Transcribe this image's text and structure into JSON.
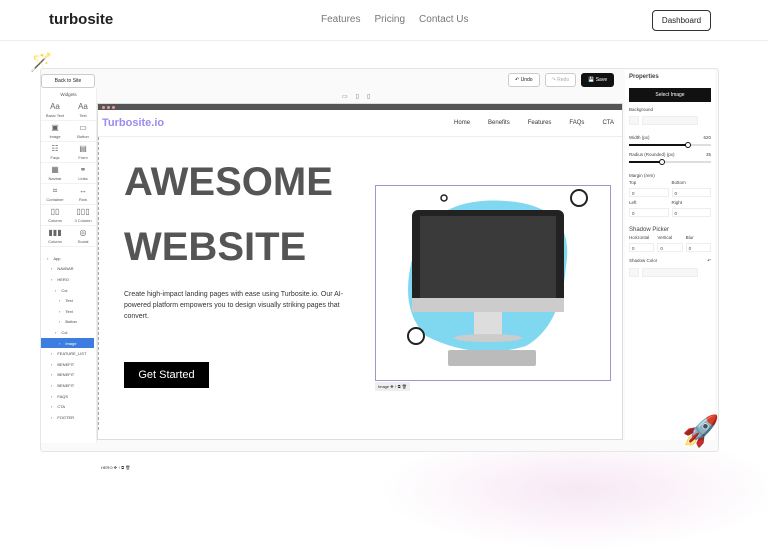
{
  "nav": {
    "logo": "turbosite",
    "links": [
      "Features",
      "Pricing",
      "Contact Us"
    ],
    "dashboard": "Dashboard"
  },
  "editor": {
    "back": "Back to Site",
    "widgets_title": "Widgets",
    "widgets": [
      {
        "label": "Basic Text",
        "icon": "Aa"
      },
      {
        "label": "Text",
        "icon": "Aa"
      },
      {
        "label": "Image",
        "icon": "▣"
      },
      {
        "label": "Button",
        "icon": "▭"
      },
      {
        "label": "Faqs",
        "icon": "☷"
      },
      {
        "label": "Form",
        "icon": "▤"
      },
      {
        "label": "Navbar",
        "icon": "▦"
      },
      {
        "label": "Links",
        "icon": "⚭"
      },
      {
        "label": "Container",
        "icon": "⌗"
      },
      {
        "label": "Row",
        "icon": "↔"
      },
      {
        "label": "Column",
        "icon": "▯▯"
      },
      {
        "label": "3 Column",
        "icon": "▯▯▯"
      },
      {
        "label": "Column",
        "icon": "▮▮▮"
      },
      {
        "label": "Social",
        "icon": "◎"
      }
    ],
    "tree": [
      {
        "label": "App",
        "d": 0
      },
      {
        "label": "NAVBAR",
        "d": 1
      },
      {
        "label": "HERO",
        "d": 1
      },
      {
        "label": "Col",
        "d": 2
      },
      {
        "label": "Text",
        "d": 3
      },
      {
        "label": "Text",
        "d": 3
      },
      {
        "label": "Button",
        "d": 3
      },
      {
        "label": "Col",
        "d": 2
      },
      {
        "label": "Image",
        "d": 3,
        "selected": true
      },
      {
        "label": "FEATURE_LIST",
        "d": 1
      },
      {
        "label": "BENEFIT",
        "d": 1
      },
      {
        "label": "BENEFIT",
        "d": 1
      },
      {
        "label": "BENEFIT",
        "d": 1
      },
      {
        "label": "FAQS",
        "d": 1
      },
      {
        "label": "CTA",
        "d": 1
      },
      {
        "label": "FOOTER",
        "d": 1
      }
    ],
    "undo": "Undo",
    "redo": "Redo",
    "save": "Save"
  },
  "site": {
    "brand": "Turbosite.io",
    "menu": [
      "Home",
      "Benefits",
      "Features",
      "FAQs",
      "CTA"
    ],
    "h1a": "AWESOME",
    "h1b": "WEBSITE",
    "para": "Create high-impact landing pages with ease using Turbosite.io. Our AI-powered platform empowers you to design visually striking pages that convert.",
    "cta": "Get Started",
    "image_label": "Image",
    "hero_label": "HERO"
  },
  "props": {
    "title": "Properties",
    "select": "Select Image",
    "background": "Background",
    "width_label": "Width (px)",
    "width": 620,
    "width_pct": 0.72,
    "radius_label": "Radius (Rounded) (px)",
    "radius": 35,
    "radius_pct": 0.4,
    "margin": "Margin (rem)",
    "top": "Top",
    "bottom": "Bottom",
    "left": "Left",
    "right": "Right",
    "zero": "0",
    "shadow": "Shadow Picker",
    "horizontal": "Horizontal",
    "vertical": "Vertical",
    "blur": "Blur",
    "shadow_color": "Shadow Color"
  },
  "colors": {
    "brand": "#9b8cf0",
    "selected": "#3d7de0"
  }
}
